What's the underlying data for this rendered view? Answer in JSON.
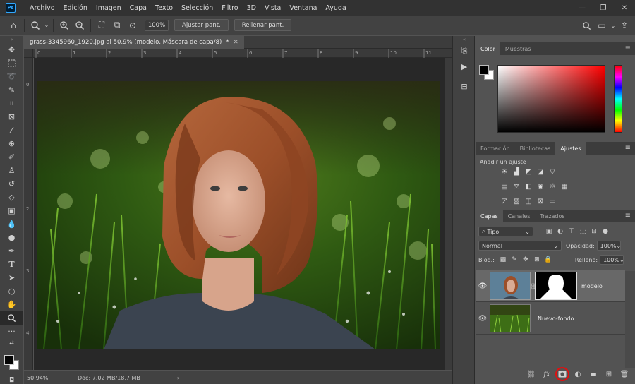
{
  "menubar": {
    "app_icon": "Ps",
    "items": [
      "Archivo",
      "Edición",
      "Imagen",
      "Capa",
      "Texto",
      "Selección",
      "Filtro",
      "3D",
      "Vista",
      "Ventana",
      "Ayuda"
    ],
    "window_controls": [
      "minimize-icon",
      "maximize-icon",
      "close-icon"
    ]
  },
  "options": {
    "zoom_field": "100%",
    "fit_screen_label": "Ajustar pant.",
    "fill_screen_label": "Rellenar pant."
  },
  "document": {
    "tab_title": "grass-3345960_1920.jpg al 50,9% (modelo, Máscara de capa/8)",
    "tab_modified": "*",
    "ruler_top_labels": [
      "0",
      "1",
      "2",
      "3",
      "4",
      "5",
      "6",
      "7",
      "8",
      "9",
      "10",
      "11"
    ],
    "ruler_left_labels": [
      "0",
      "1",
      "2",
      "3",
      "4"
    ],
    "status_zoom": "50,94%",
    "status_doc": "Doc: 7,02 MB/18,7 MB"
  },
  "color_panel": {
    "tabs": [
      "Color",
      "Muestras"
    ],
    "active_tab": "Color",
    "hue_color": "#ff0000"
  },
  "adjustments_panel": {
    "tabs": [
      "Formación",
      "Bibliotecas",
      "Ajustes"
    ],
    "active_tab": "Ajustes",
    "title": "Añadir un ajuste"
  },
  "layers_panel": {
    "tabs": [
      "Capas",
      "Canales",
      "Trazados"
    ],
    "active_tab": "Capas",
    "filter_kind": "Tipo",
    "blend_mode": "Normal",
    "opacity_label": "Opacidad:",
    "opacity_value": "100%",
    "lock_label": "Bloq.:",
    "fill_label": "Relleno:",
    "fill_value": "100%",
    "layers": [
      {
        "name": "modelo",
        "selected": true,
        "has_mask": true
      },
      {
        "name": "Nuevo-fondo",
        "selected": false,
        "has_mask": false
      }
    ]
  }
}
